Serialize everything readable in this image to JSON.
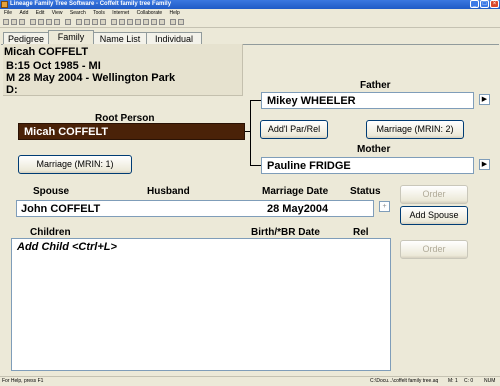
{
  "window": {
    "title": "Lineage Family Tree Software - Coffelt family tree Family"
  },
  "menu": [
    "File",
    "Add",
    "Edit",
    "View",
    "Search",
    "Tools",
    "Internet",
    "Collaborate",
    "Help"
  ],
  "tabs": [
    "Pedigree",
    "Family",
    "Name List",
    "Individual"
  ],
  "info": {
    "name": "Micah COFFELT",
    "birth": "B:15 Oct 1985 - MI",
    "marriage": "M 28 May 2004 - Wellington Park",
    "death": "D:"
  },
  "father": {
    "label": "Father",
    "name": "Mikey WHEELER"
  },
  "mother": {
    "label": "Mother",
    "name": "Pauline FRIDGE"
  },
  "root": {
    "label": "Root Person",
    "name": "Micah COFFELT"
  },
  "buttons": {
    "marriage_root": "Marriage (MRIN: 1)",
    "add_par_rel": "Add'l Par/Rel",
    "marriage_parents": "Marriage (MRIN: 2)",
    "order1": "Order",
    "add_spouse": "Add Spouse",
    "order2": "Order",
    "plus": "+"
  },
  "spouse_headers": {
    "spouse": "Spouse",
    "husband": "Husband",
    "marriage_date": "Marriage Date",
    "status": "Status"
  },
  "spouse": {
    "name": "John COFFELT",
    "date": "28 May2004"
  },
  "children_headers": {
    "children": "Children",
    "birth": "Birth/*BR Date",
    "rel": "Rel"
  },
  "children": {
    "add_child": "Add Child <Ctrl+L>"
  },
  "status": {
    "help": "For Help, press F1",
    "file": "C:\\Docu...\\coffelt family tree.aq",
    "c1": "M: 1",
    "c2": "C: 0",
    "mode": "NUM"
  },
  "colors": {
    "root_bg": "#4a2208",
    "title_bg": "#1f5bc6"
  }
}
